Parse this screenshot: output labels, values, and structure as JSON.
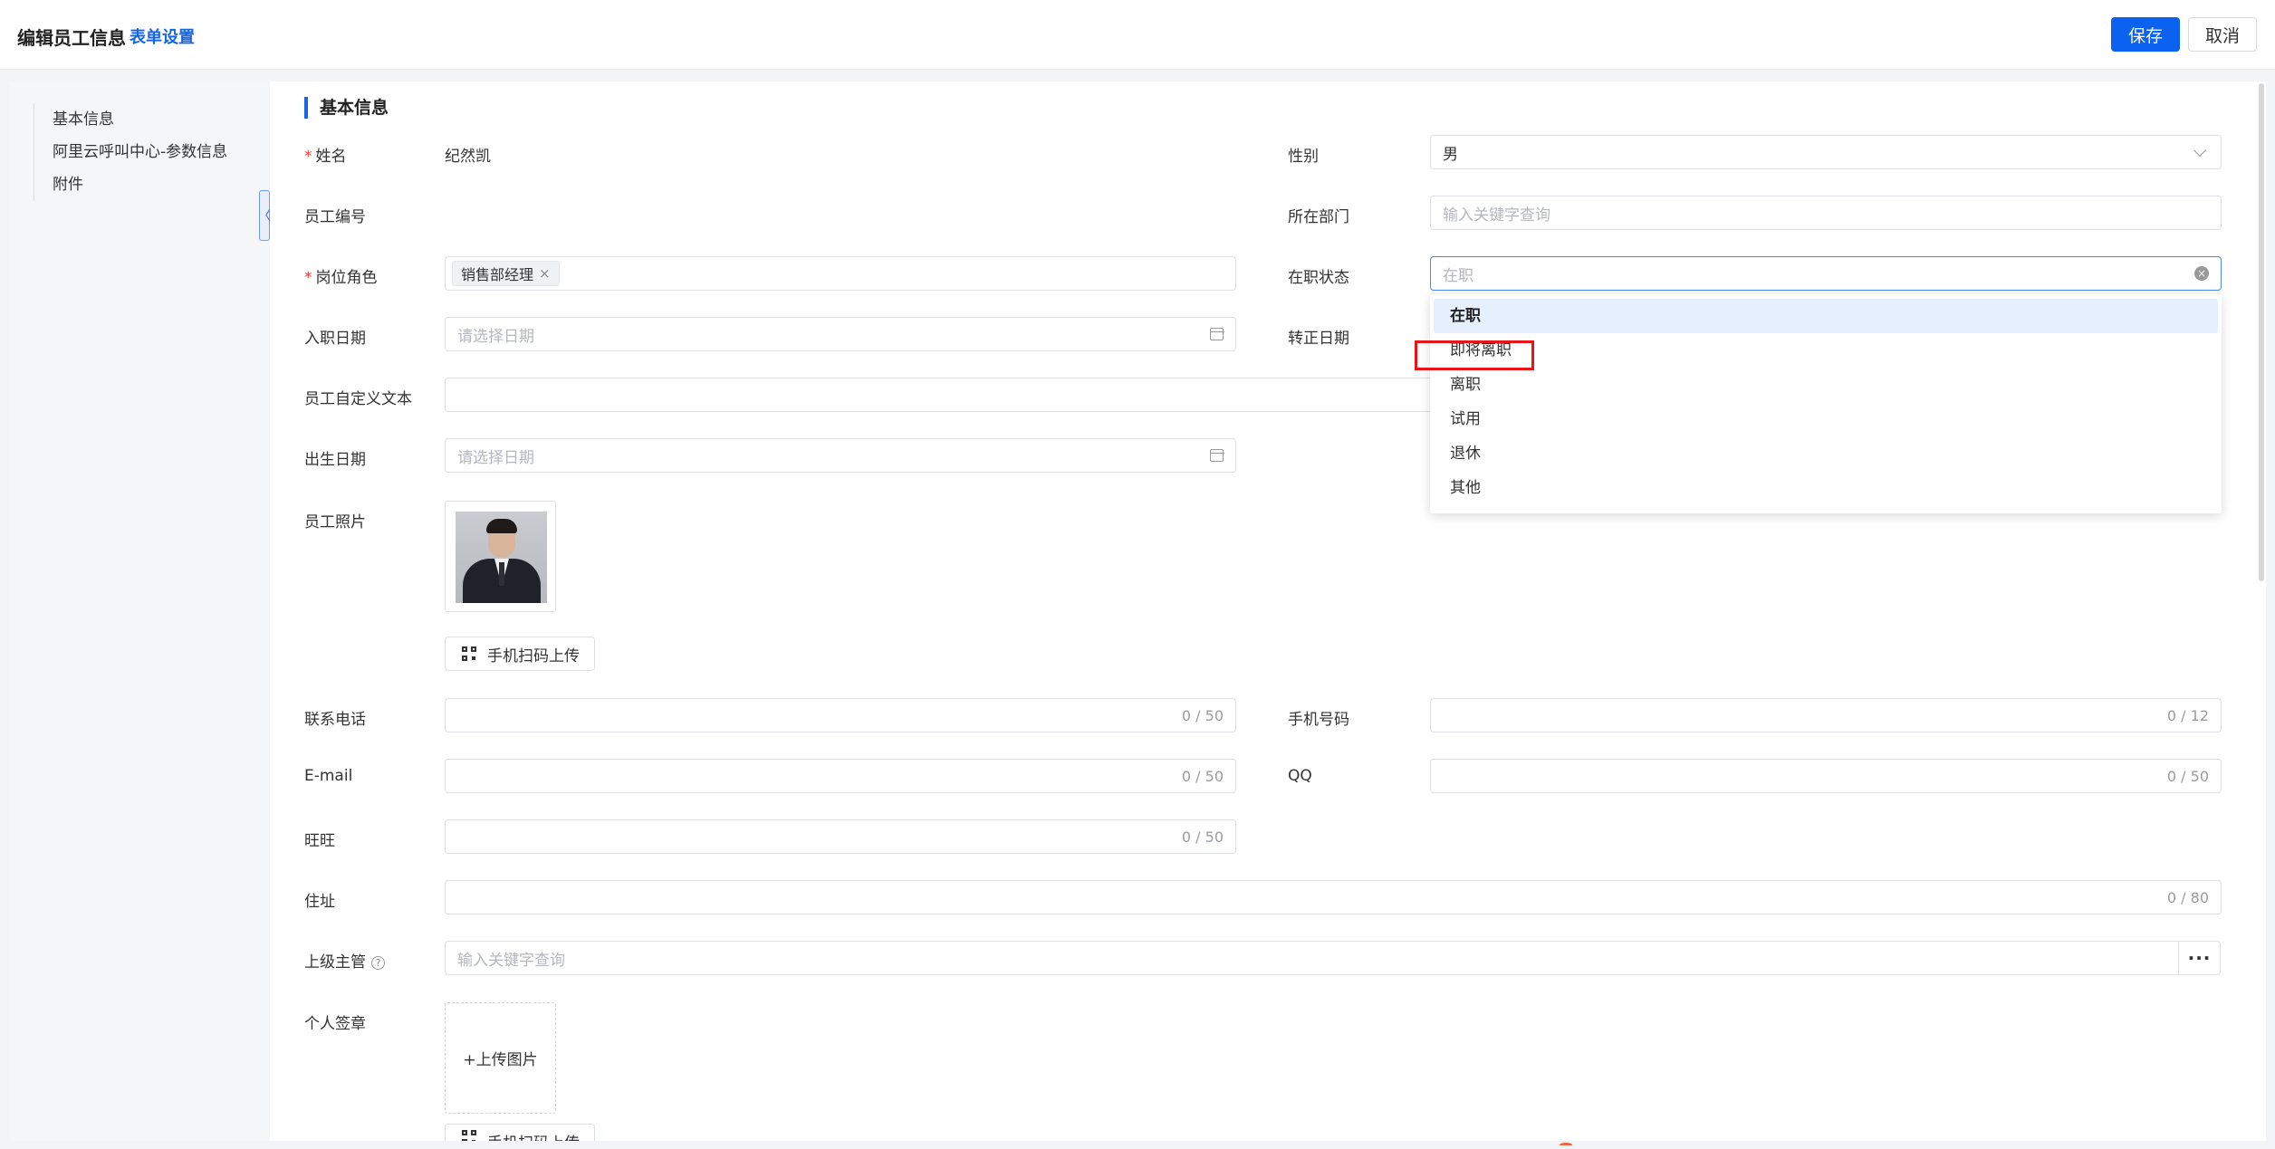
{
  "header": {
    "title": "编辑员工信息",
    "form_settings": "表单设置",
    "save": "保存",
    "cancel": "取消"
  },
  "sidebar": {
    "items": [
      "基本信息",
      "阿里云呼叫中心-参数信息",
      "附件"
    ],
    "collapse": "〈"
  },
  "section": {
    "title": "基本信息"
  },
  "fields": {
    "name": {
      "label": "姓名",
      "value": "纪然凯"
    },
    "gender": {
      "label": "性别",
      "value": "男"
    },
    "employee_no": {
      "label": "员工编号"
    },
    "department": {
      "label": "所在部门",
      "placeholder": "输入关键字查询"
    },
    "role": {
      "label": "岗位角色",
      "tag": "销售部经理",
      "tag_remove": "×"
    },
    "status": {
      "label": "在职状态",
      "placeholder": "在职",
      "clear": "×"
    },
    "hire_date": {
      "label": "入职日期",
      "placeholder": "请选择日期"
    },
    "regular_date": {
      "label": "转正日期"
    },
    "custom_text": {
      "label": "员工自定义文本"
    },
    "birth_date": {
      "label": "出生日期",
      "placeholder": "请选择日期"
    },
    "photo": {
      "label": "员工照片",
      "scan_upload": "手机扫码上传"
    },
    "phone": {
      "label": "联系电话",
      "count": "0 / 50"
    },
    "mobile": {
      "label": "手机号码",
      "count": "0 / 12"
    },
    "email": {
      "label": "E-mail",
      "count": "0 / 50"
    },
    "qq": {
      "label": "QQ",
      "count": "0 / 50"
    },
    "wangwang": {
      "label": "旺旺",
      "count": "0 / 50"
    },
    "address": {
      "label": "住址",
      "count": "0 / 80"
    },
    "supervisor": {
      "label": "上级主管",
      "help": "?",
      "placeholder": "输入关键字查询",
      "more": "···"
    },
    "signature": {
      "label": "个人签章",
      "upload": "+上传图片",
      "scan_upload": "手机扫码上传"
    }
  },
  "status_dropdown": {
    "options": [
      "在职",
      "即将离职",
      "离职",
      "试用",
      "退休",
      "其他"
    ],
    "selected": "在职",
    "highlighted": "即将离职"
  },
  "colors": {
    "primary": "#0b62f0",
    "link": "#1565e6",
    "required": "#e83a3a",
    "highlight": "#e8141a"
  }
}
